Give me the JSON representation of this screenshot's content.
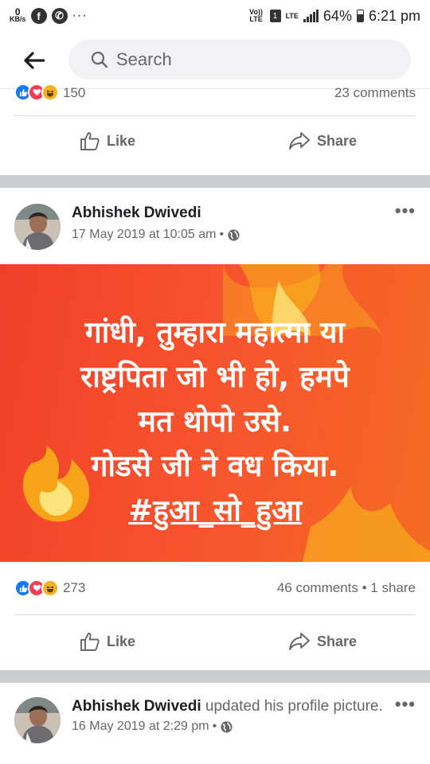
{
  "status_bar": {
    "kbs_value": "0",
    "kbs_unit": "KB/s",
    "volte": "Vo)) LTE",
    "sim": "1",
    "network": "LTE",
    "battery": "64%",
    "time": "6:21 pm",
    "icons": [
      "facebook-icon",
      "whatsapp-icon",
      "more-dots-icon",
      "signal-icon",
      "battery-icon"
    ]
  },
  "header": {
    "search_placeholder": "Search"
  },
  "post_top": {
    "reaction_count": "150",
    "comments": "23 comments",
    "like_label": "Like",
    "share_label": "Share"
  },
  "post_main": {
    "author": "Abhishek Dwivedi",
    "date": "17 May 2019 at 10:05 am",
    "date_sep": "•",
    "banner_lines": [
      "गांधी, तुम्हारा महात्मा या",
      "राष्ट्रपिता जो भी हो, हमपे",
      "मत थोपो उसे.",
      "गोडसे जी ने वध किया.",
      "#हुआ_सो_हुआ"
    ],
    "reaction_count": "273",
    "stats": "46 comments • 1 share",
    "like_label": "Like",
    "share_label": "Share",
    "colors": {
      "banner_start": "#f0402a",
      "banner_end": "#f46b22",
      "text": "#ffffff"
    }
  },
  "post_next": {
    "author": "Abhishek Dwivedi",
    "action": "updated his profile picture.",
    "date": "16 May 2019 at 2:29 pm",
    "date_sep": "•"
  },
  "colors": {
    "accent": "#1877f2",
    "secondary_text": "#65676b",
    "separator": "#c9ccd1"
  }
}
